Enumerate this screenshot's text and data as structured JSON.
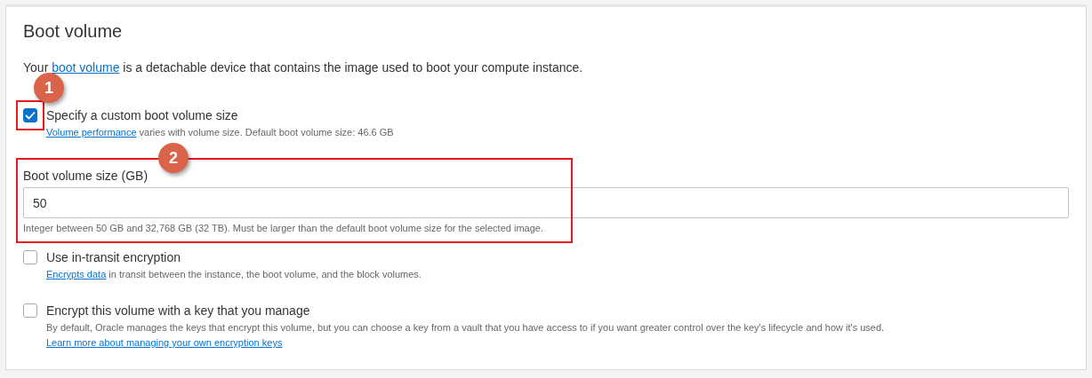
{
  "section": {
    "title": "Boot volume",
    "description": [
      {
        "text": "Your "
      },
      {
        "link": "boot volume"
      },
      {
        "text": " is a detachable device that contains the image used to boot your compute instance."
      }
    ],
    "options": [
      {
        "kind": "checkbox",
        "checked": true,
        "label": "Specify a custom boot volume size",
        "help": [
          {
            "link": "Volume performance"
          },
          {
            "text": " varies with volume size. Default boot volume size: 46.6 GB"
          }
        ],
        "callout": "1"
      },
      {
        "kind": "field",
        "label": "Boot volume size (GB)",
        "value": "50",
        "help": [
          {
            "text": "Integer between 50 GB and 32,768 GB (32 TB). Must be larger than the default boot volume size for the selected image."
          }
        ],
        "callout": "2"
      },
      {
        "kind": "checkbox",
        "checked": false,
        "label": "Use in-transit encryption",
        "help": [
          {
            "link": "Encrypts data"
          },
          {
            "text": " in transit between the instance, the boot volume, and the block volumes."
          }
        ]
      },
      {
        "kind": "checkbox",
        "checked": false,
        "label": "Encrypt this volume with a key that you manage",
        "help": [
          {
            "text": "By default, Oracle manages the keys that encrypt this volume, but you can choose a key from a vault that you have access to if you want greater control over the key's lifecycle and how it's used. "
          },
          {
            "link": "Learn more about managing your own encryption keys"
          }
        ]
      }
    ]
  }
}
